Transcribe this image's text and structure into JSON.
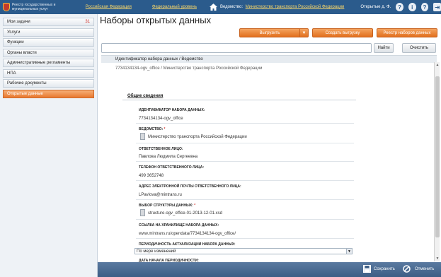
{
  "header": {
    "logo_text": "Реестр государственных и муниципальных услуг",
    "links": [
      "Российская Федерация",
      "Федеральный уровень"
    ],
    "department_label": "Ведомство:",
    "department_value": "Министерство транспорта Российской Федерации",
    "user": "Открытые д. Ф.",
    "icons": [
      "home-icon",
      "help-icon",
      "info-icon",
      "question-icon",
      "logout-icon"
    ]
  },
  "sidebar": {
    "items": [
      {
        "label": "Мои задачи",
        "count": "31",
        "active": false
      },
      {
        "label": "Услуги",
        "count": "",
        "active": false
      },
      {
        "label": "Функции",
        "count": "",
        "active": false
      },
      {
        "label": "Органы власти",
        "count": "",
        "active": false
      },
      {
        "label": "Административные регламенты",
        "count": "",
        "active": false
      },
      {
        "label": "НПА",
        "count": "",
        "active": false
      },
      {
        "label": "Рабочие документы",
        "count": "",
        "active": false
      },
      {
        "label": "Открытые данные",
        "count": "",
        "active": true
      }
    ]
  },
  "main": {
    "title": "Наборы открытых данных",
    "buttons": {
      "upload": "Выгрузить",
      "create_upload": "Создать выгрузку",
      "registry": "Реестр наборов данных",
      "find": "Найти",
      "clear": "Очистить"
    },
    "search": {
      "value": "",
      "placeholder": ""
    },
    "breadcrumb_headers": "Идентификатор набора данных /   Ведомство",
    "breadcrumb_path": "7734134134-ogv_office / Министерство транспорта Российской Федерации"
  },
  "form": {
    "section_title": "Общие сведения",
    "fields": {
      "dataset_id_label": "Идентификатор набора данных:",
      "dataset_id_value": "7734134134-ogv_office",
      "department_label": "Ведомство:",
      "department_value": "Министерство транспорта Российской Федерации",
      "responsible_label": "Ответственное лицо:",
      "responsible_value": "Павлова Людмила Сергеевна",
      "phone_label": "Телефон ответственного лица:",
      "phone_value": "499 3652748",
      "email_label": "Адрес электронной почты ответственного лица:",
      "email_value": "LPavlova@mintrans.ru",
      "structure_label": "Выбор структуры данных:",
      "structure_value": "structure-ogv_office-01-2013-12-01.xsd",
      "link_label": "Ссылка на хранилище набора данных:",
      "link_value": "www.mintrans.ru/opendata/7734134134-ogv_office/",
      "periodicity_label": "Периодичность актуализации набора данных:",
      "periodicity_value": "По мере изменений",
      "start_date_label": "Дата начала периодичности:"
    }
  },
  "footer": {
    "save": "Сохранить",
    "cancel": "Отменить"
  },
  "colors": {
    "header_bg": "#2b5b8c",
    "accent": "#e2701e",
    "link": "#f6d56a"
  }
}
